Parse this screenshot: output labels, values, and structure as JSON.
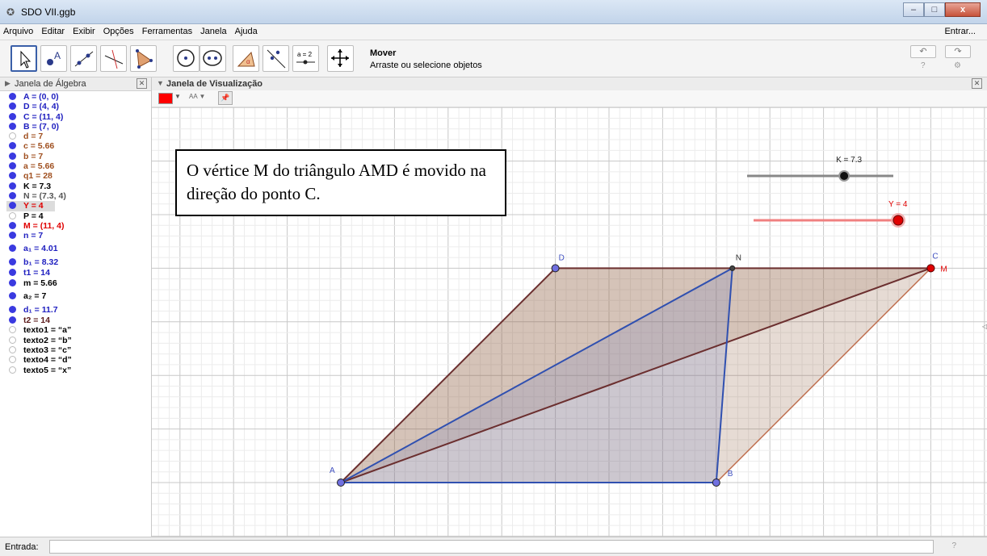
{
  "window": {
    "title": "SDO VII.ggb",
    "minimize": "–",
    "maximize": "□",
    "close": "x"
  },
  "menu": {
    "items": [
      "Arquivo",
      "Editar",
      "Exibir",
      "Opções",
      "Ferramentas",
      "Janela",
      "Ajuda"
    ],
    "sign_in": "Entrar..."
  },
  "toolbar": {
    "tools": [
      "move-tool",
      "point-tool",
      "line-tool",
      "perpendicular-tool",
      "polygon-tool",
      "circle-tool",
      "conic-tool",
      "angle-tool",
      "reflect-tool",
      "slider-tool",
      "move-view-tool"
    ],
    "slider_tool_label": "a = 2",
    "active_tool_name": "Mover",
    "active_tool_desc": "Arraste ou selecione objetos",
    "undo": "↶",
    "redo": "↷",
    "help": "?",
    "settings": "⚙"
  },
  "algebra": {
    "header": "Janela de Álgebra",
    "items": [
      {
        "name": "A",
        "value": "A = (0, 0)",
        "color": "#2020c0",
        "visible": true
      },
      {
        "name": "D",
        "value": "D = (4, 4)",
        "color": "#2020c0",
        "visible": true
      },
      {
        "name": "C",
        "value": "C = (11, 4)",
        "color": "#2020c0",
        "visible": true
      },
      {
        "name": "B",
        "value": "B = (7, 0)",
        "color": "#2020c0",
        "visible": true
      },
      {
        "name": "d",
        "value": "d = 7",
        "color": "#a05020",
        "visible": false
      },
      {
        "name": "c",
        "value": "c = 5.66",
        "color": "#a05020",
        "visible": true
      },
      {
        "name": "b",
        "value": "b = 7",
        "color": "#a05020",
        "visible": true
      },
      {
        "name": "a",
        "value": "a = 5.66",
        "color": "#a05020",
        "visible": true
      },
      {
        "name": "q1",
        "value": "q1 = 28",
        "color": "#a05020",
        "visible": true
      },
      {
        "name": "K",
        "value": "K = 7.3",
        "color": "#000000",
        "visible": true
      },
      {
        "name": "N",
        "value": "N = (7.3, 4)",
        "color": "#555555",
        "visible": true
      },
      {
        "name": "Y",
        "value": "Y = 4",
        "color": "#e00000",
        "visible": true
      },
      {
        "name": "P",
        "value": "P = 4",
        "color": "#000000",
        "visible": false
      },
      {
        "name": "M",
        "value": "M = (11, 4)",
        "color": "#e00000",
        "visible": true
      },
      {
        "name": "n",
        "value": "n = 7",
        "color": "#2020c0",
        "visible": true
      },
      {
        "name": "a1",
        "value": "a₁ = 4.01",
        "color": "#2020c0",
        "visible": true
      },
      {
        "name": "b1",
        "value": "b₁ = 8.32",
        "color": "#2020c0",
        "visible": true
      },
      {
        "name": "t1",
        "value": "t1 = 14",
        "color": "#2020c0",
        "visible": true
      },
      {
        "name": "m",
        "value": "m = 5.66",
        "color": "#000000",
        "visible": true
      },
      {
        "name": "a2",
        "value": "a₂ = 7",
        "color": "#000000",
        "visible": true
      },
      {
        "name": "d1",
        "value": "d₁ = 11.7",
        "color": "#2020c0",
        "visible": true
      },
      {
        "name": "t2",
        "value": "t2 = 14",
        "color": "#5a1a1a",
        "visible": true
      },
      {
        "name": "texto1",
        "value": "texto1 = “a”",
        "color": "#000000",
        "visible": false
      },
      {
        "name": "texto2",
        "value": "texto2 = “b”",
        "color": "#000000",
        "visible": false
      },
      {
        "name": "texto3",
        "value": "texto3 = “c”",
        "color": "#000000",
        "visible": false
      },
      {
        "name": "texto4",
        "value": "texto4 = “d”",
        "color": "#000000",
        "visible": false
      },
      {
        "name": "texto5",
        "value": "texto5 = “x”",
        "color": "#000000",
        "visible": false
      }
    ]
  },
  "graphics": {
    "header": "Janela de Visualização",
    "font_button": "AA",
    "text_box": "O vértice M do triângulo AMD é movido na direção do ponto C.",
    "slider_k": {
      "label": "K = 7.3",
      "value": 7.3,
      "min": 0,
      "max": 11
    },
    "slider_y": {
      "label": "Y = 4",
      "value": 4,
      "min": 0,
      "max": 4
    },
    "points": [
      {
        "name": "A",
        "x": 0,
        "y": 0,
        "label": "A"
      },
      {
        "name": "B",
        "x": 7,
        "y": 0,
        "label": "B"
      },
      {
        "name": "C",
        "x": 11,
        "y": 4,
        "label": "C"
      },
      {
        "name": "D",
        "x": 4,
        "y": 4,
        "label": "D"
      },
      {
        "name": "N",
        "x": 7.3,
        "y": 4,
        "label": "N"
      },
      {
        "name": "M",
        "x": 11,
        "y": 4,
        "label": "M"
      }
    ],
    "colors": {
      "brown": "#6b2f2f",
      "fill_brown": "#8b5a3c",
      "blue": "#3050b0",
      "fill_blue": "#7080c0",
      "red": "#e00000",
      "point": "#7070e0"
    }
  },
  "input_bar": {
    "label": "Entrada:",
    "help": "?"
  }
}
